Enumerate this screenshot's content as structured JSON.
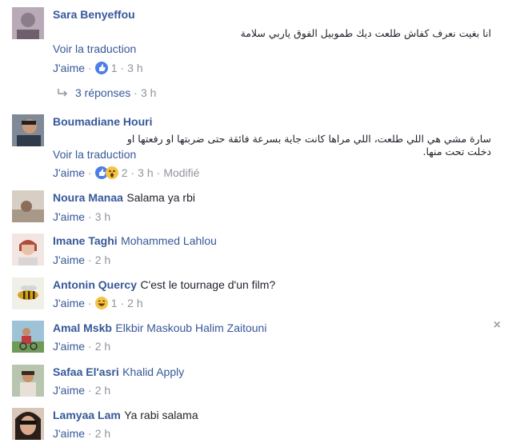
{
  "ui": {
    "like": "J'aime",
    "dot": "·",
    "translate": "Voir la traduction",
    "close": "×"
  },
  "comments": [
    {
      "name": "Sara Benyeffou",
      "text": "",
      "rtl": "انا بغيت نعرف كفاش طلعت ديك طموبيل الفوق ياربي سلامة",
      "translate": true,
      "reaction_count": "1",
      "time": "3 h",
      "reactions": [
        "like"
      ]
    },
    {
      "name": "Boumadiane Houri",
      "text": "",
      "rtl1": "سارة مشي هي اللي طلعت، اللي مراها كانت جاية بسرعة فائقة حتى ضربتها او رفعتها او دخلت تحت منها.",
      "translate": true,
      "reaction_count": "2",
      "time": "3 h",
      "edited": "Modifié",
      "reactions": [
        "like",
        "haha"
      ]
    },
    {
      "name": "Noura Manaa",
      "text": "Salama ya rbi",
      "time": "3 h"
    },
    {
      "name": "Imane Taghi",
      "text": "Mohammed Lahlou",
      "time": "2 h",
      "text_is_link": true
    },
    {
      "name": "Antonin Quercy",
      "text": "C'est le tournage d'un film?",
      "reaction_count": "1",
      "time": "2 h",
      "reactions": [
        "haha"
      ]
    },
    {
      "name": "Amal Mskb",
      "text": "Elkbir Maskoub Halim Zaitouni",
      "time": "2 h",
      "text_is_link": true
    },
    {
      "name": "Safaa El'asri",
      "text": "Khalid Apply",
      "time": "2 h",
      "text_is_link": true
    },
    {
      "name": "Lamyaa Lam",
      "text": "Ya rabi salama",
      "time": "2 h"
    }
  ],
  "replies_label": "3 réponses",
  "replies_time": "3 h",
  "colors": {
    "link": "#365899",
    "meta": "#90949c",
    "text": "#1d2129"
  }
}
